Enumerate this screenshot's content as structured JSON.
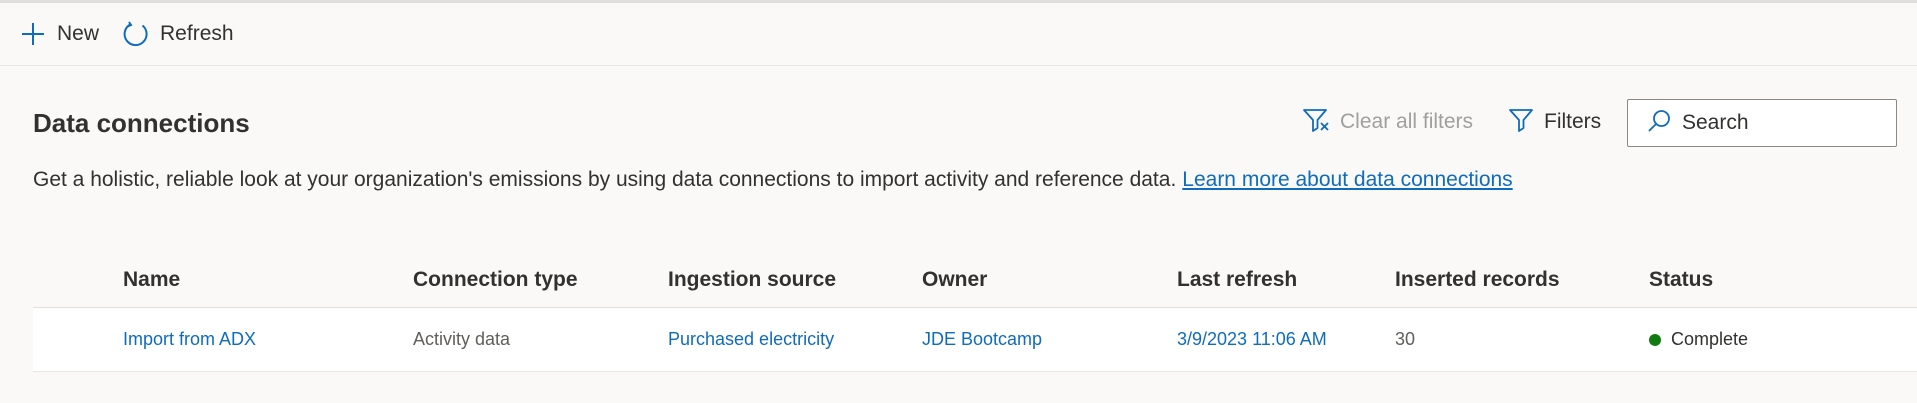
{
  "toolbar": {
    "new_label": "New",
    "refresh_label": "Refresh"
  },
  "header": {
    "title": "Data connections",
    "clear_filters_label": "Clear all filters",
    "filters_label": "Filters",
    "search_placeholder": "Search"
  },
  "description": {
    "text": "Get a holistic, reliable look at your organization's emissions by using data connections to import activity and reference data.",
    "link_text": "Learn more about data connections"
  },
  "table": {
    "columns": [
      "Name",
      "Connection type",
      "Ingestion source",
      "Owner",
      "Last refresh",
      "Inserted records",
      "Status"
    ],
    "rows": [
      {
        "name": "Import from ADX",
        "connection_type": "Activity data",
        "ingestion_source": "Purchased electricity",
        "owner": "JDE Bootcamp",
        "last_refresh": "3/9/2023 11:06 AM",
        "inserted_records": "30",
        "status": "Complete"
      }
    ]
  },
  "colors": {
    "accent": "#0f6cbd",
    "status_complete": "#107c10",
    "disabled_text": "#a19f9d"
  }
}
